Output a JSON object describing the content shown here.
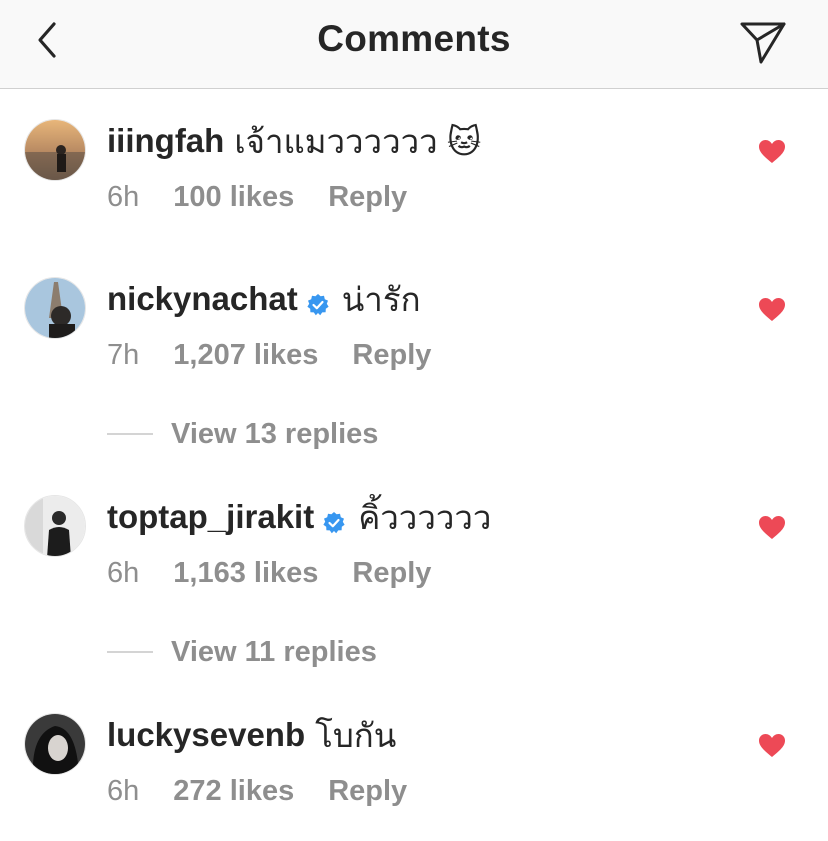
{
  "header": {
    "title": "Comments"
  },
  "comments": [
    {
      "username": "iiingfah",
      "verified": false,
      "text": "เจ้าแมวววววว 🐱",
      "time": "6h",
      "likes": "100 likes",
      "reply": "Reply"
    },
    {
      "username": "nickynachat",
      "verified": true,
      "text": "น่ารัก",
      "time": "7h",
      "likes": "1,207 likes",
      "reply": "Reply"
    },
    {
      "username": "toptap_jirakit",
      "verified": true,
      "text": "คิ้วววววว",
      "time": "6h",
      "likes": "1,163 likes",
      "reply": "Reply"
    },
    {
      "username": "luckysevenb",
      "verified": false,
      "text": "โบกัน",
      "time": "6h",
      "likes": "272 likes",
      "reply": "Reply"
    }
  ],
  "view_replies": [
    {
      "label": "View 13 replies"
    },
    {
      "label": "View 11 replies"
    }
  ],
  "colors": {
    "heart": "#ed4956",
    "verified": "#3897f0",
    "muted": "#8e8e8e",
    "text": "#262626"
  },
  "icons": {
    "back": "chevron-left-icon",
    "send": "paper-plane-icon",
    "like": "heart-icon",
    "verified": "verified-badge-icon"
  }
}
